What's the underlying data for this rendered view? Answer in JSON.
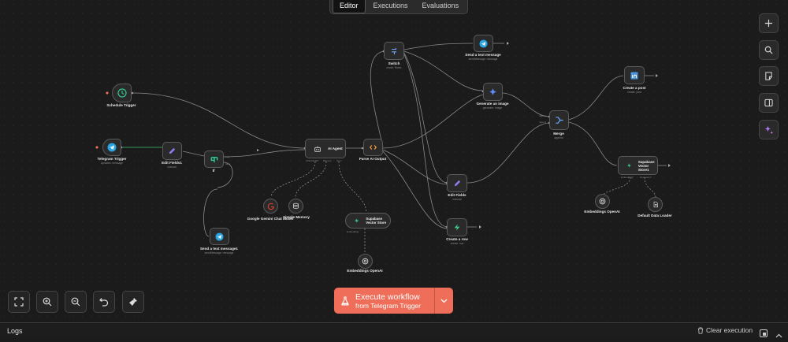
{
  "tabs": {
    "editor": "Editor",
    "executions": "Executions",
    "evaluations": "Evaluations"
  },
  "nodes": {
    "schedule": {
      "title": "Schedule Trigger",
      "icon": "clock-icon"
    },
    "telegram_trigger": {
      "title": "Telegram Trigger",
      "sub": "Updates: message",
      "icon": "telegram-icon"
    },
    "edit_fields1": {
      "title": "Edit Fields1",
      "sub": "manual",
      "icon": "pencil-icon"
    },
    "if": {
      "title": "If",
      "icon": "if-icon"
    },
    "send_text1": {
      "title": "Send a text message1",
      "sub": "sendMessage: message",
      "icon": "telegram-icon"
    },
    "ai_agent": {
      "title": "AI Agent",
      "icon": "robot-icon",
      "ports": {
        "chat_model": "Chat Model*",
        "memory": "Memory",
        "tool": "Tool"
      }
    },
    "gemini": {
      "title": "Google Gemini Chat Model",
      "icon": "google-icon"
    },
    "simple_memory": {
      "title": "Simple Memory",
      "icon": "database-icon"
    },
    "supabase_store": {
      "title": "Supabase Vector Store",
      "icon": "supabase-icon",
      "port": "Embedding"
    },
    "embeddings1": {
      "title": "Embeddings OpenAI",
      "icon": "openai-icon"
    },
    "parse_output": {
      "title": "Parse AI Output",
      "icon": "code-icon"
    },
    "switch": {
      "title": "Switch",
      "sub": "mode: Rules",
      "icon": "switch-icon"
    },
    "send_text": {
      "title": "Send a text message",
      "sub": "sendMessage: message",
      "icon": "telegram-icon"
    },
    "generate_image": {
      "title": "Generate an image",
      "sub": "generate: image",
      "icon": "gemini-icon"
    },
    "edit_fields": {
      "title": "Edit Fields",
      "sub": "manual",
      "icon": "pencil-icon"
    },
    "create_row": {
      "title": "Create a row",
      "sub": "create: row",
      "icon": "supabase-icon"
    },
    "merge": {
      "title": "Merge",
      "sub": "append",
      "icon": "merge-icon",
      "ports": {
        "input1": "Input 1",
        "input2": "Input 2"
      }
    },
    "create_post": {
      "title": "Create a post",
      "sub": "create: post",
      "icon": "linkedin-icon"
    },
    "supabase_store1": {
      "title": "Supabase Vector Store1",
      "icon": "supabase-icon",
      "ports": {
        "embedding": "Embedding*",
        "loader": "Document*"
      }
    },
    "embeddings2": {
      "title": "Embeddings OpenAI",
      "icon": "openai-icon"
    },
    "data_loader": {
      "title": "Default Data Loader",
      "icon": "document-icon"
    }
  },
  "right_toolbar": [
    "plus-icon",
    "search-icon",
    "sticky-note-icon",
    "panel-icon",
    "ai-sparkle-icon"
  ],
  "bottom_toolbar": [
    "fit-view-icon",
    "zoom-in-icon",
    "zoom-out-icon",
    "undo-icon",
    "clean-up-icon"
  ],
  "execute": {
    "line1": "Execute workflow",
    "line2": "from Telegram Trigger",
    "color": "#ee6e59"
  },
  "logs": {
    "title": "Logs",
    "clear": "Clear execution"
  },
  "colors": {
    "background": "#1b1b1b",
    "node": "#2a2a2a",
    "accent": "#ee6e59",
    "telegram": "#2aa3e0",
    "supabase": "#3ecf8e"
  }
}
